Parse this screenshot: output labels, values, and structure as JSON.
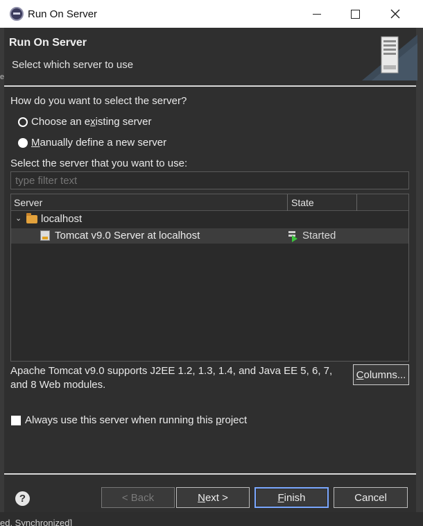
{
  "window": {
    "title": "Run On Server"
  },
  "banner": {
    "title": "Run On Server",
    "subtitle": "Select which server to use"
  },
  "selection": {
    "question": "How do you want to select the server?",
    "options": [
      {
        "label_pre": "Choose an e",
        "label_u": "x",
        "label_post": "isting server",
        "selected": true
      },
      {
        "label_pre": "",
        "label_u": "M",
        "label_post": "anually define a new server",
        "selected": false
      }
    ]
  },
  "server_list": {
    "label": "Select the server that you want to use:",
    "filter_placeholder": "type filter text",
    "columns": [
      "Server",
      "State"
    ],
    "rows": [
      {
        "name": "localhost",
        "state": "",
        "type": "folder",
        "expanded": true
      },
      {
        "name": "Tomcat v9.0 Server at localhost",
        "state": "Started",
        "type": "server",
        "selected": true
      }
    ]
  },
  "description": "Apache Tomcat v9.0 supports J2EE 1.2, 1.3, 1.4, and Java EE 5, 6, 7, and 8 Web modules.",
  "columns_button": {
    "pre": "",
    "u": "C",
    "post": "olumns..."
  },
  "always_use": {
    "pre": "Always use this server when running this ",
    "u": "p",
    "post": "roject",
    "checked": false
  },
  "buttons": {
    "back": "< Back",
    "next_u": "N",
    "next_post": "ext >",
    "finish_u": "F",
    "finish_post": "inish",
    "cancel": "Cancel"
  },
  "background": {
    "left_fragment": "e",
    "status_text": "ed. Synchronized]"
  },
  "icons": {
    "help": "?"
  },
  "colors": {
    "dialog_bg": "#2f2f2f",
    "default_button_border": "#7aa7ff",
    "started_green": "#3cc43c"
  }
}
